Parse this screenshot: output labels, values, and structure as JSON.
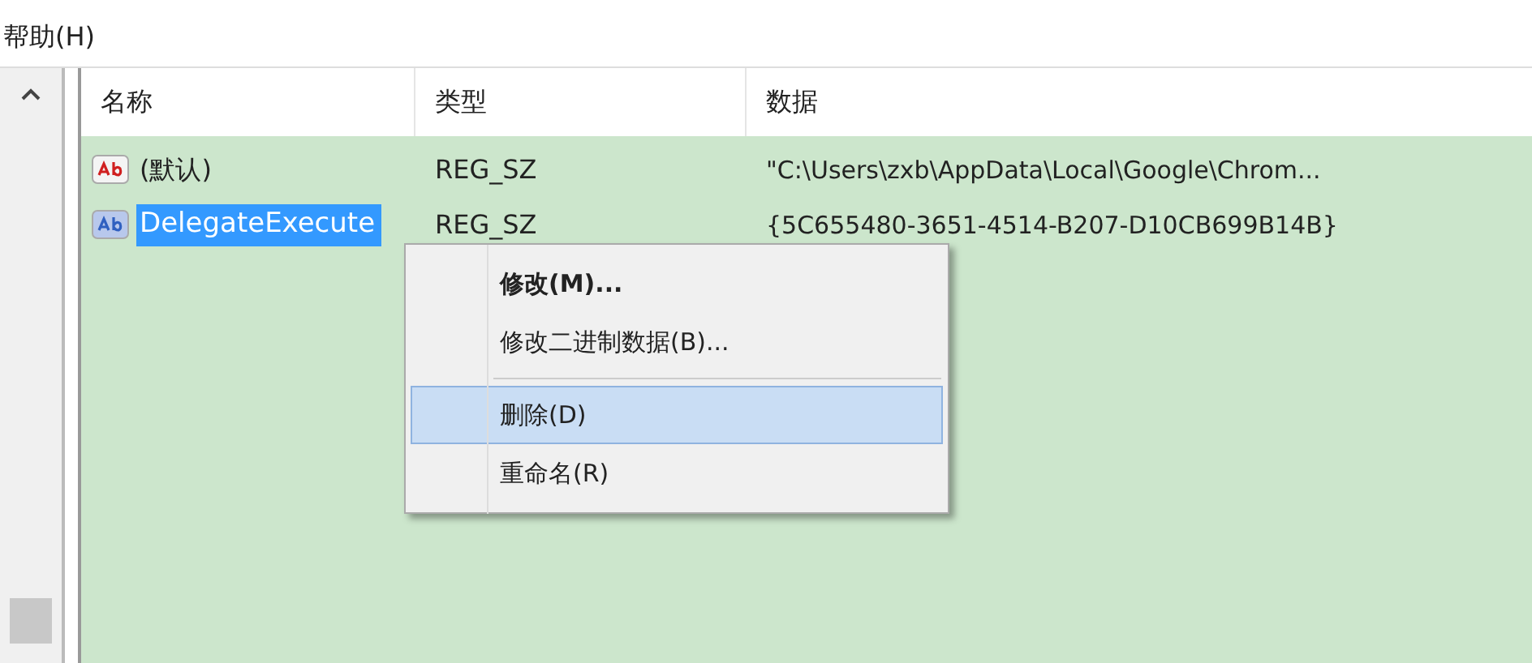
{
  "menu_bar": {
    "items": [
      "帮助(H)"
    ]
  },
  "table": {
    "columns": [
      "名称",
      "类型",
      "数据"
    ],
    "rows": [
      {
        "name": "(默认)",
        "type": "REG_SZ",
        "data": "\"C:\\Users\\zxb\\AppData\\Local\\Google\\Chrom...",
        "selected": false
      },
      {
        "name": "DelegateExecute",
        "type": "REG_SZ",
        "data": "{5C655480-3651-4514-B207-D10CB699B14B}",
        "selected": true
      }
    ]
  },
  "context_menu": {
    "items": [
      {
        "kind": "item",
        "label": "修改(M)...",
        "default": true,
        "selected": false
      },
      {
        "kind": "item",
        "label": "修改二进制数据(B)...",
        "default": false,
        "selected": false
      },
      {
        "kind": "separator"
      },
      {
        "kind": "item",
        "label": "删除(D)",
        "default": false,
        "selected": true
      },
      {
        "kind": "item",
        "label": "重命名(R)",
        "default": false,
        "selected": false
      }
    ]
  }
}
